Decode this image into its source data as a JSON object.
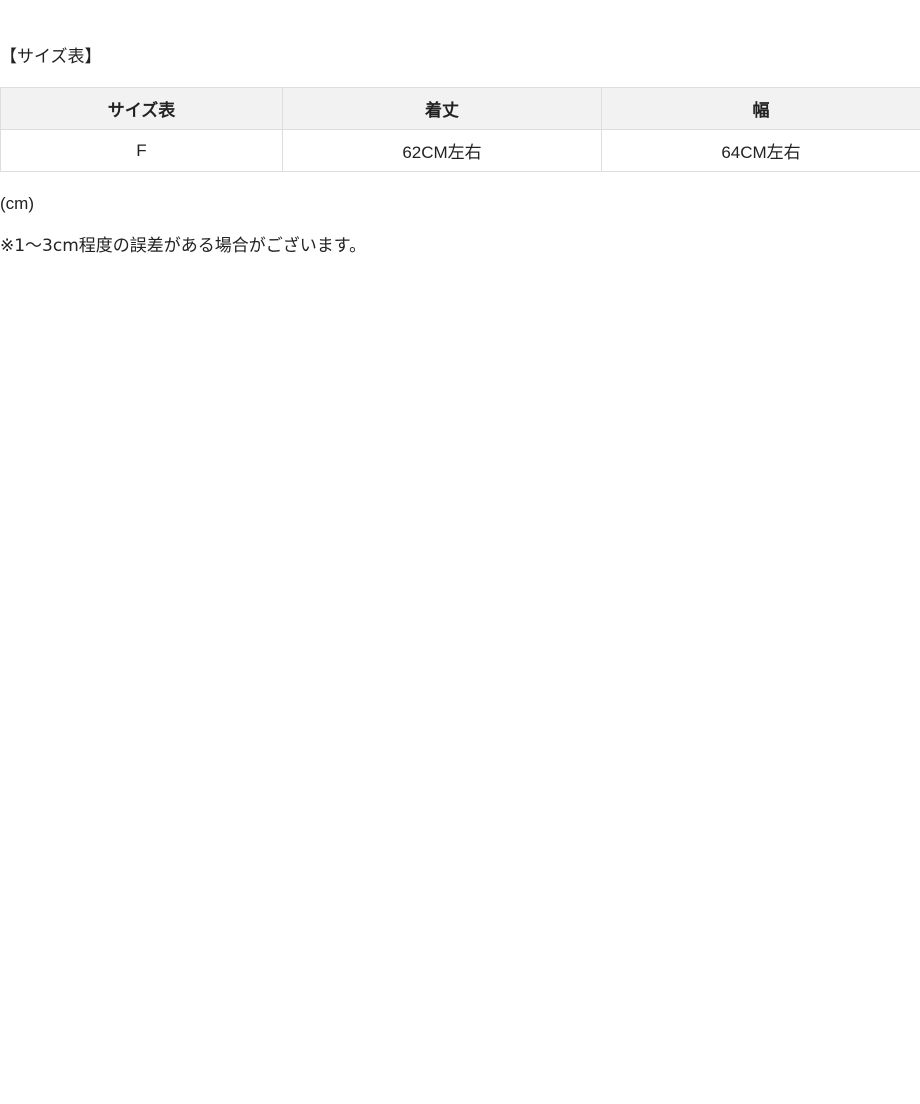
{
  "heading": "【サイズ表】",
  "table": {
    "headers": [
      "サイズ表",
      "着丈",
      "幅"
    ],
    "rows": [
      [
        "F",
        "62CM左右",
        "64CM左右"
      ]
    ]
  },
  "unit_note": "(cm)",
  "disclaimer": "※1～3cm程度の誤差がある場合がございます。"
}
